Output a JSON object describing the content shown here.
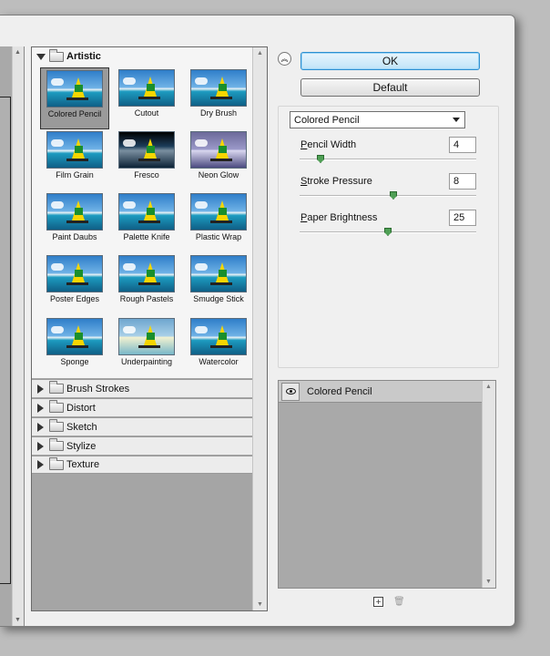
{
  "gallery": {
    "categories": {
      "artistic": "Artistic",
      "brush_strokes": "Brush Strokes",
      "distort": "Distort",
      "sketch": "Sketch",
      "stylize": "Stylize",
      "texture": "Texture"
    },
    "filters": [
      "Colored Pencil",
      "Cutout",
      "Dry Brush",
      "Film Grain",
      "Fresco",
      "Neon Glow",
      "Paint Daubs",
      "Palette Knife",
      "Plastic Wrap",
      "Poster Edges",
      "Rough Pastels",
      "Smudge Stick",
      "Sponge",
      "Underpainting",
      "Watercolor"
    ],
    "selected_filter": "Colored Pencil"
  },
  "buttons": {
    "ok": "OK",
    "default": "Default"
  },
  "settings": {
    "filter_select": "Colored Pencil",
    "params": [
      {
        "label_first": "P",
        "label_rest": "encil Width",
        "value": "4",
        "level": 0.12
      },
      {
        "label_first": "S",
        "label_rest": "troke Pressure",
        "value": "8",
        "level": 0.53
      },
      {
        "label_first": "P",
        "label_rest": "aper Brightness",
        "value": "25",
        "level": 0.5
      }
    ]
  },
  "layers": {
    "items": [
      {
        "name": "Colored Pencil"
      }
    ]
  }
}
